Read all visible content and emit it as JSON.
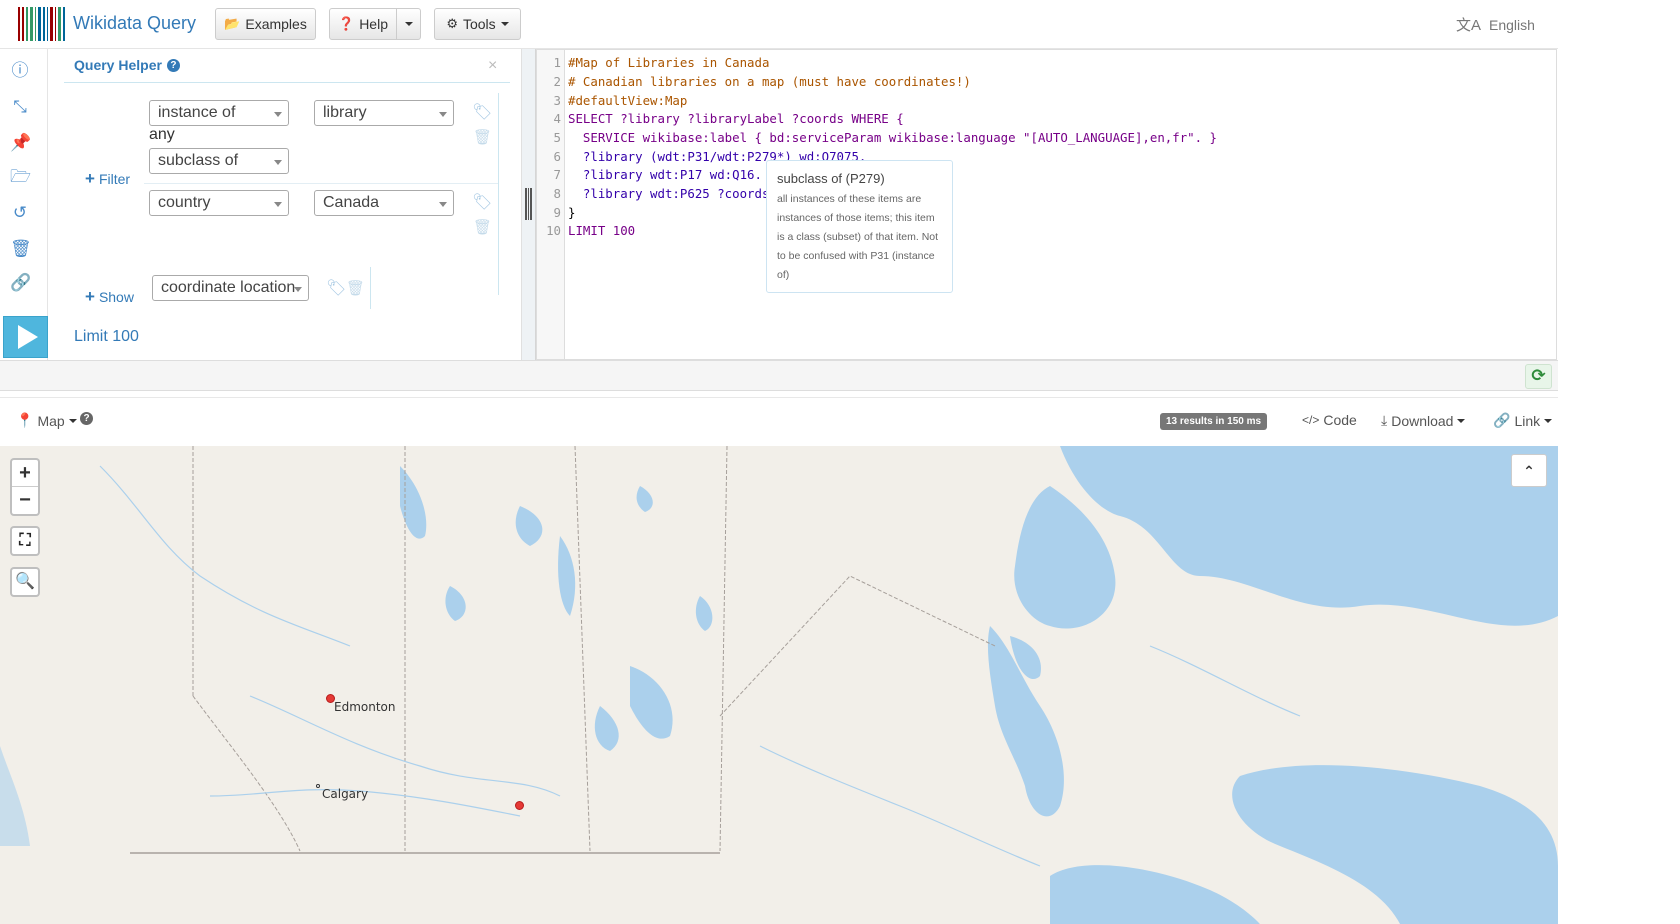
{
  "app": {
    "title": "Wikidata Query"
  },
  "nav": {
    "examples": "Examples",
    "help": "Help",
    "tools": "Tools",
    "language": "English"
  },
  "colors": {
    "accent": "#337ab7",
    "run": "#4fb6dd",
    "marker": "#e53935",
    "water": "#abd0ec",
    "land": "#f2efe9"
  },
  "sidebar_icons": [
    "info-icon",
    "expand-icon",
    "pin-icon",
    "folder-open-icon",
    "history-icon",
    "trash-icon",
    "link-icon"
  ],
  "query_helper": {
    "title": "Query Helper",
    "close": "×",
    "filter_label": "Filter",
    "show_label": "Show",
    "filters": [
      {
        "property": "instance of",
        "value": "library",
        "any": "any",
        "sub_property": "subclass of"
      },
      {
        "property": "country",
        "value": "Canada"
      }
    ],
    "shows": [
      {
        "property": "coordinate location"
      }
    ],
    "limit": "Limit 100"
  },
  "editor": {
    "lines": [
      "#Map of Libraries in Canada",
      "# Canadian libraries on a map (must have coordinates!)",
      "#defaultView:Map",
      "SELECT ?library ?libraryLabel ?coords WHERE {",
      "  SERVICE wikibase:label { bd:serviceParam wikibase:language \"[AUTO_LANGUAGE],en,fr\". }",
      "  ?library (wdt:P31/wdt:P279*) wd:Q7075.",
      "  ?library wdt:P17 wd:Q16.",
      "  ?library wdt:P625 ?coords",
      "}",
      "LIMIT 100"
    ],
    "tooltip": {
      "title": "subclass of (P279)",
      "body": "all instances of these items are instances of those items; this item is a class (subset) of that item. Not to be confused with P31 (instance of)"
    }
  },
  "results": {
    "view": "Map",
    "count_badge": "13 results in 150 ms",
    "code": "Code",
    "download": "Download",
    "link": "Link"
  },
  "map": {
    "cities": [
      "Edmonton",
      "Calgary"
    ],
    "zoom_in": "+",
    "zoom_out": "−"
  }
}
